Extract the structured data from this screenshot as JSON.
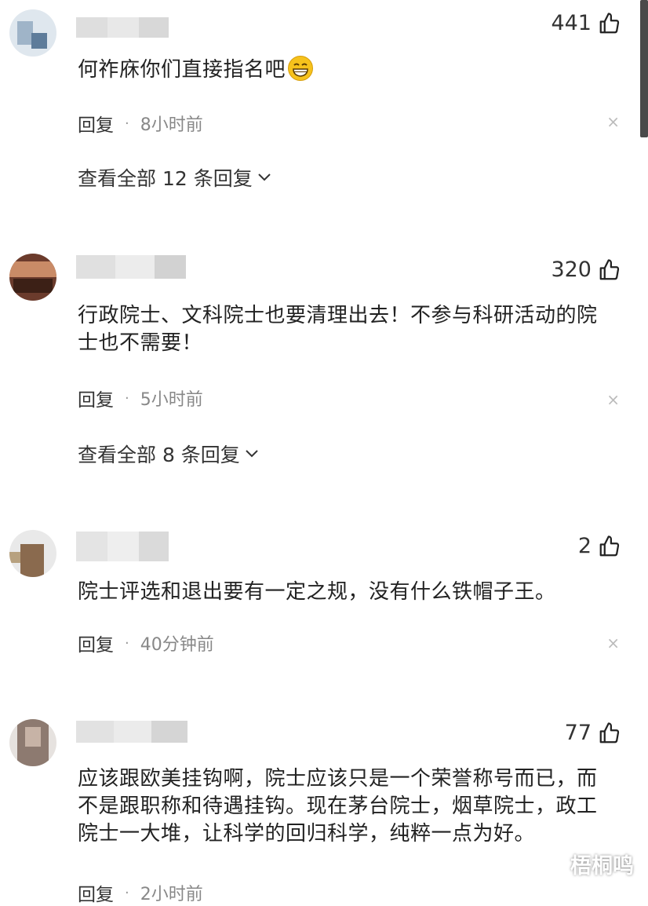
{
  "comments": [
    {
      "likes": "441",
      "text": "何祚庥你们直接指名吧",
      "reply_label": "回复",
      "time": "8小时前",
      "view_all": "查看全部 12 条回复",
      "close": "×"
    },
    {
      "likes": "320",
      "text_line1": "行政院士、文科院士也要清理出去！不参与科研活动的院",
      "text_line2": "士也不需要！",
      "reply_label": "回复",
      "time": "5小时前",
      "view_all": "查看全部 8 条回复",
      "close": "×"
    },
    {
      "likes": "2",
      "text": "院士评选和退出要有一定之规，没有什么铁帽子王。",
      "reply_label": "回复",
      "time": "40分钟前",
      "close": "×"
    },
    {
      "likes": "77",
      "text_line1": "应该跟欧美挂钩啊，院士应该只是一个荣誉称号而已，而",
      "text_line2": "不是跟职称和待遇挂钩。现在茅台院士，烟草院士，政工",
      "text_line3": "院士一大堆，让科学的回归科学，纯粹一点为好。",
      "reply_label": "回复",
      "time": "2小时前"
    }
  ],
  "watermark": "梧桐鸣",
  "icons": {
    "like": "thumbs-up-icon",
    "emoji": "grinning-face-icon",
    "chevron": "chevron-down-icon",
    "close": "close-icon"
  },
  "colors": {
    "emoji": "#f6c21c",
    "text": "#222222",
    "meta": "#888888"
  }
}
